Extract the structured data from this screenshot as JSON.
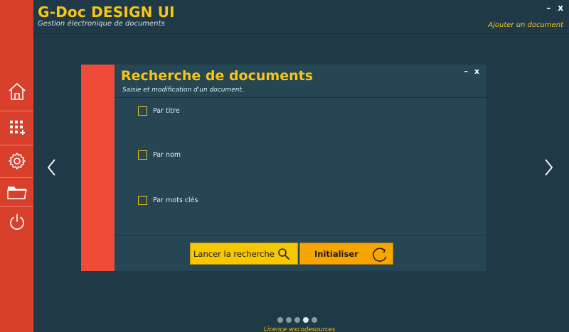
{
  "app": {
    "title": "G-Doc DESIGN UI",
    "subtitle": "Gestion électronique de documents",
    "add_document": "Ajouter un document",
    "minimize": "–",
    "close": "x"
  },
  "sidebar": {
    "items": [
      {
        "icon": "home-icon"
      },
      {
        "icon": "apps-grid-icon"
      },
      {
        "icon": "settings-gear-icon"
      },
      {
        "icon": "folder-icon"
      },
      {
        "icon": "power-icon"
      }
    ]
  },
  "modal": {
    "title": "Recherche de documents",
    "subtitle": "Saisie et modification d'un document.",
    "minimize": "–",
    "close": "x",
    "options": [
      {
        "label": "Par titre",
        "checked": false
      },
      {
        "label": "Par nom",
        "checked": false
      },
      {
        "label": "Par mots clés",
        "checked": false
      }
    ],
    "search_button": "Lancer la recherche",
    "reset_button": "Initialiser"
  },
  "pager": {
    "count": 5,
    "active_index": 3
  },
  "footer": {
    "licence": "Licence wxcodesources"
  },
  "colors": {
    "sidebar": "#d9402c",
    "background": "#1f3a46",
    "accent_yellow": "#f5c518",
    "modal": "#264654",
    "search_button": "#f7c700",
    "reset_button": "#f7a600"
  }
}
